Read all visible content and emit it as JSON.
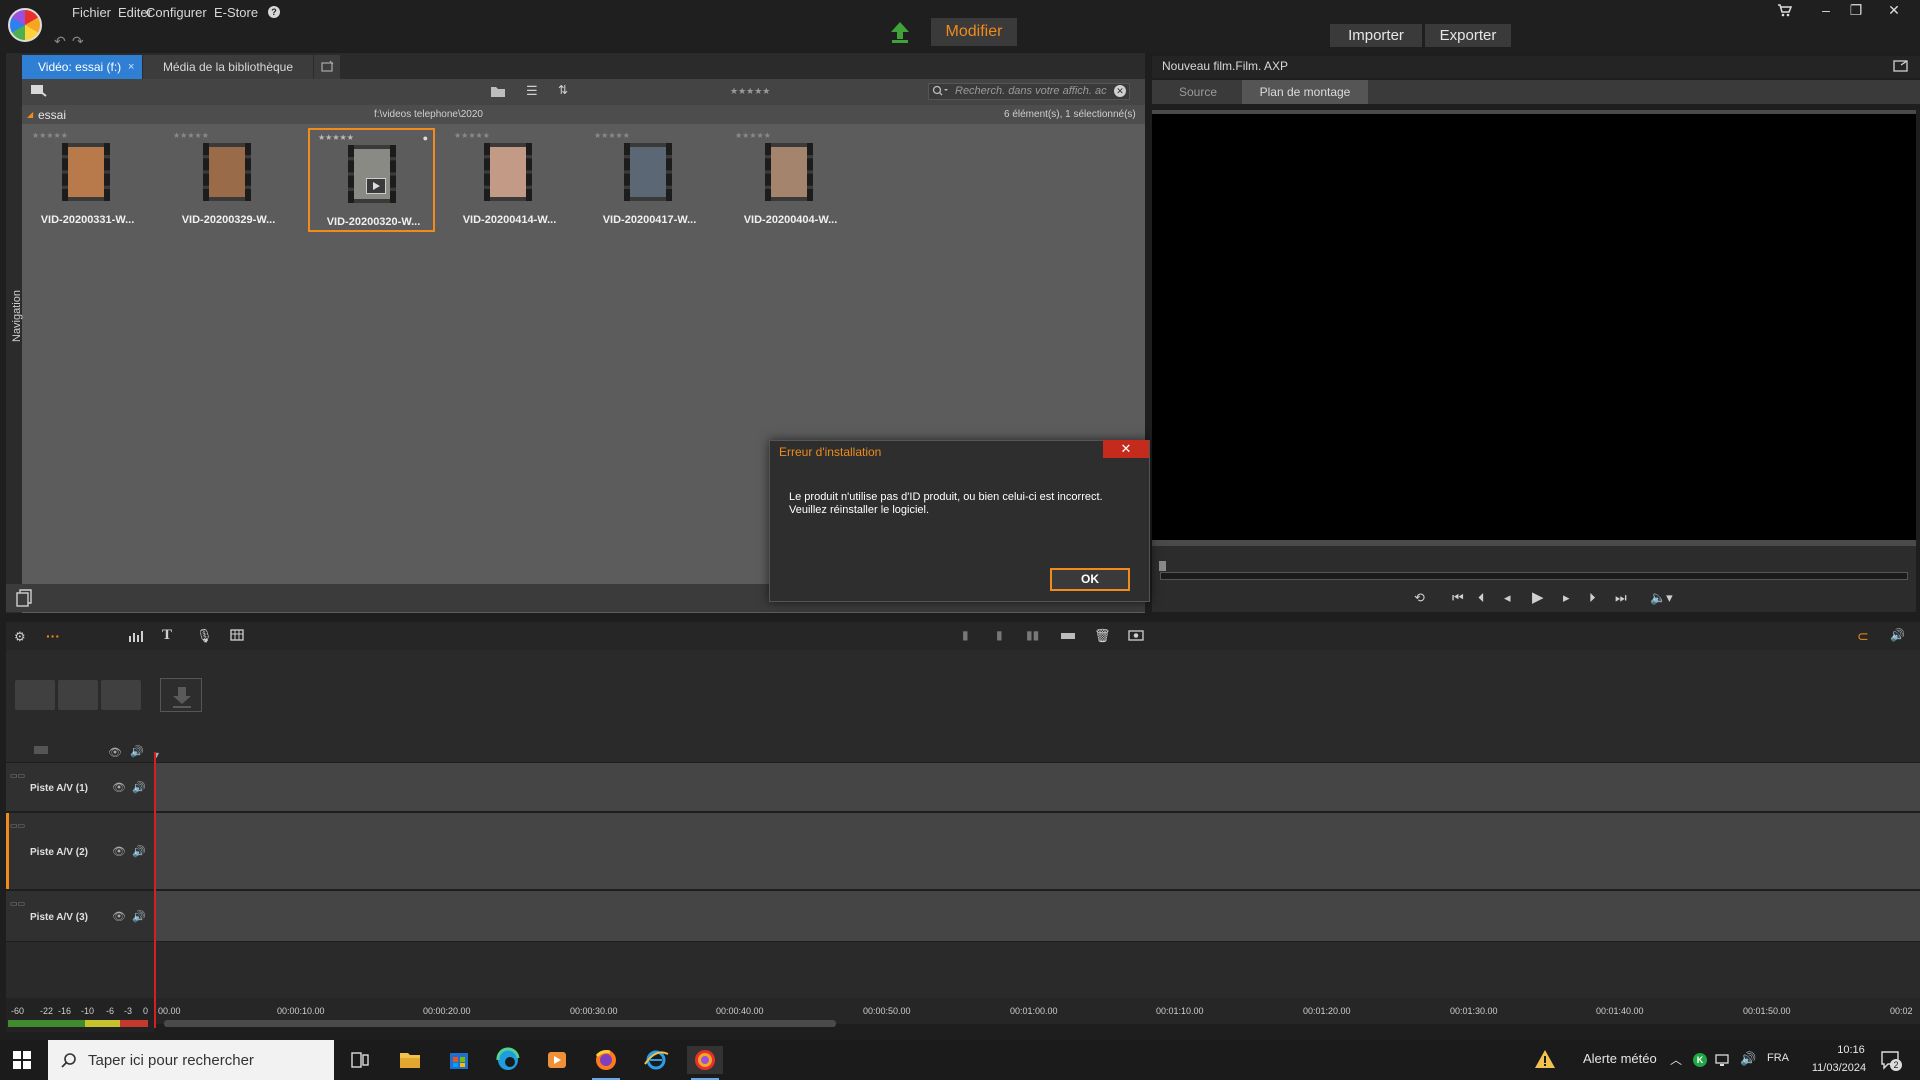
{
  "menu": {
    "items": [
      "Fichier",
      "Editer",
      "Configurer",
      "E-Store"
    ],
    "help": "?"
  },
  "header": {
    "modifier": "Modifier",
    "importer": "Importer",
    "exporter": "Exporter"
  },
  "library": {
    "tabs": {
      "active": "Vidéo: essai (f:)",
      "active_close": "×",
      "second": "Média de la bibliothèque"
    },
    "search_placeholder": "Recherch. dans votre affich. ac",
    "folder_name": "essai",
    "folder_path": "f:\\videos telephone\\2020",
    "item_count": "6 élément(s), 1 sélectionné(s)",
    "stars": "★★★★★",
    "nav_label": "Navigation",
    "items": [
      {
        "label": "VID-20200331-W...",
        "color": "#b87a4a"
      },
      {
        "label": "VID-20200329-W...",
        "color": "#9a6b48"
      },
      {
        "label": "VID-20200320-W...",
        "color": "#8a8a84"
      },
      {
        "label": "VID-20200414-W...",
        "color": "#c29a86"
      },
      {
        "label": "VID-20200417-W...",
        "color": "#5c6776"
      },
      {
        "label": "VID-20200404-W...",
        "color": "#a4846c"
      }
    ]
  },
  "preview": {
    "title": "Nouveau film.Film. AXP",
    "tab_source": "Source",
    "tab_montage": "Plan de montage"
  },
  "timeline": {
    "tracks": [
      "Piste A/V (1)",
      "Piste A/V (2)",
      "Piste A/V (3)"
    ],
    "ticks": [
      "00.00",
      "00:00:10.00",
      "00:00:20.00",
      "00:00:30.00",
      "00:00:40.00",
      "00:00:50.00",
      "00:01:00.00",
      "00:01:10.00",
      "00:01:20.00",
      "00:01:30.00",
      "00:01:40.00",
      "00:01:50.00",
      "00:02"
    ],
    "meter_labels": [
      "-60",
      "-22",
      "-16",
      "-10",
      "-6",
      "-3",
      "0"
    ]
  },
  "dialog": {
    "title": "Erreur d'installation",
    "close": "✕",
    "message_line1": "Le produit n'utilise pas d'ID produit, ou bien celui-ci est incorrect.",
    "message_line2": "Veuillez réinstaller le logiciel.",
    "ok": "OK"
  },
  "taskbar": {
    "search_placeholder": "Taper ici pour rechercher",
    "weather": "Alerte météo",
    "language": "FRA",
    "time": "10:16",
    "date": "11/03/2024",
    "notification_count": "2"
  },
  "colors": {
    "accent": "#f08b1c",
    "tab_blue": "#2f7fd4",
    "playhead": "#d42020"
  }
}
